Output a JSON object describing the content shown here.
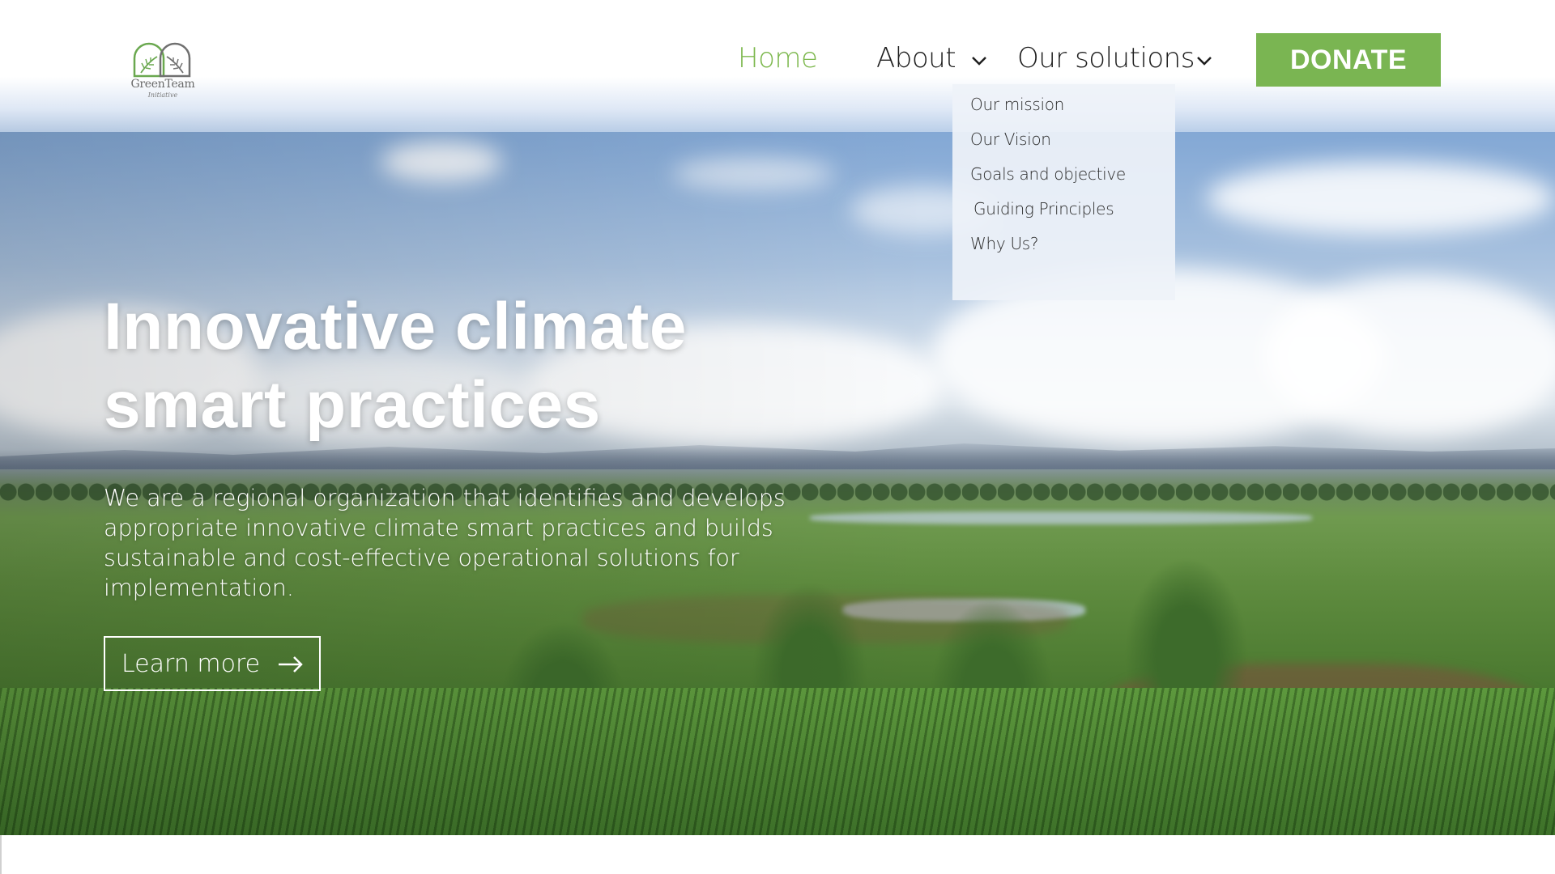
{
  "brand": {
    "name": "GreenTeam",
    "tagline": "Initiative",
    "accent_color": "#7ab552"
  },
  "nav": {
    "home": "Home",
    "about": "About",
    "solutions": "Our solutions",
    "donate": "DONATE",
    "active": "Home"
  },
  "dropdown": {
    "items": [
      "Our mission",
      "Our Vision",
      "Goals and objective",
      "Guiding Principles",
      "Why Us?"
    ]
  },
  "hero": {
    "headline_line1": "Innovative climate",
    "headline_line2": "smart practices",
    "lead": "We are a regional organization that identifies and develops appropriate innovative climate smart practices and builds sustainable and cost-effective operational solutions for implementation.",
    "cta": "Learn more",
    "cta_icon": "arrow-right-icon"
  }
}
